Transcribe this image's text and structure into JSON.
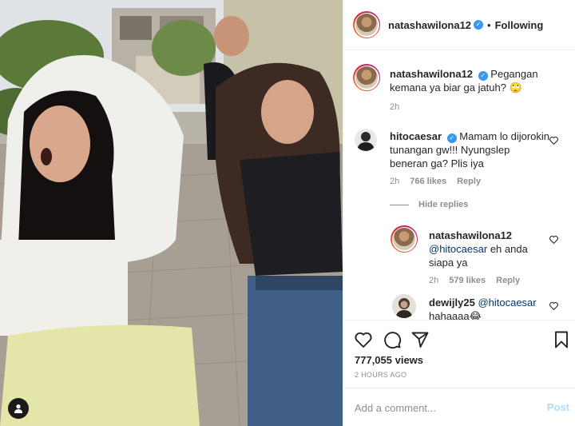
{
  "header": {
    "username": "natashawilona12",
    "verified_mark": "✓",
    "separator": "•",
    "follow_state": "Following"
  },
  "caption": {
    "username": "natashawilona12",
    "text": "Pegangan kemana ya biar ga jatuh? 🙄",
    "time": "2h"
  },
  "comments": [
    {
      "username": "hitocaesar",
      "text": "Mamam lo dijorokin tunangan gw!!! Nyungslep beneran ga? Plis iya",
      "time": "2h",
      "likes": "766 likes",
      "reply_label": "Reply"
    }
  ],
  "hide_replies_label": "Hide replies",
  "replies": [
    {
      "username": "natashawilona12",
      "mention": "@hitocaesar",
      "text": "eh anda siapa ya",
      "time": "2h",
      "likes": "579 likes",
      "reply_label": "Reply"
    },
    {
      "username": "dewijly25",
      "mention": "@hitocaesar",
      "text": "hahaaaa😂"
    }
  ],
  "stats": {
    "views": "777,055 views",
    "time_ago": "2 HOURS AGO"
  },
  "add_comment": {
    "placeholder": "Add a comment...",
    "post_label": "Post"
  },
  "icons": {
    "like": "heart-icon",
    "comment": "comment-icon",
    "share": "paper-plane-icon",
    "save": "bookmark-icon",
    "comment_like": "small-heart-icon",
    "media_user": "user-tag-icon"
  },
  "colors": {
    "verified": "#3897f0",
    "link": "#00376b",
    "post_disabled": "#b3dbff",
    "muted": "#8e8e8e"
  }
}
